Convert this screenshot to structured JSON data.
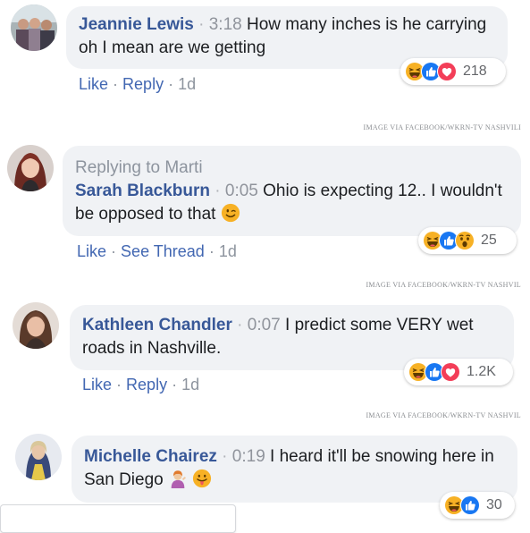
{
  "comments": [
    {
      "name": "Jeannie Lewis",
      "time": "3:18",
      "text": "How many inches is he carrying oh I mean are we getting",
      "actions": [
        "Like",
        "Reply"
      ],
      "age": "1d",
      "reactions": [
        "haha-icon",
        "like-icon",
        "love-icon"
      ],
      "reaction_count": "218",
      "credit": "IMAGE VIA FACEBOOK/WKRN-TV NASHVILI"
    },
    {
      "replying": "Replying to Marti",
      "name": "Sarah Blackburn",
      "time": "0:05",
      "text": "Ohio is expecting 12.. I wouldn't be opposed to that",
      "actions": [
        "Like",
        "See Thread"
      ],
      "age": "1d",
      "reactions": [
        "haha-icon",
        "like-icon",
        "wow-icon"
      ],
      "reaction_count": "25",
      "credit": "IMAGE VIA FACEBOOK/WKRN-TV NASHVIL"
    },
    {
      "name": "Kathleen Chandler",
      "time": "0:07",
      "text": "I predict some VERY wet roads in Nashville.",
      "actions": [
        "Like",
        "Reply"
      ],
      "age": "1d",
      "reactions": [
        "haha-icon",
        "like-icon",
        "love-icon"
      ],
      "reaction_count": "1.2K",
      "credit": "IMAGE VIA FACEBOOK/WKRN-TV NASHVIL"
    },
    {
      "name": "Michelle Chairez",
      "time": "0:19",
      "text": "I heard it'll be snowing here in San Diego",
      "reactions": [
        "haha-icon",
        "like-icon"
      ],
      "reaction_count": "30"
    }
  ],
  "colors": {
    "name": "#385898",
    "action": "#4267b2",
    "bubble": "#f0f2f5",
    "like": "#1877f2",
    "love": "#f33e58",
    "haha": "#f7b125"
  }
}
